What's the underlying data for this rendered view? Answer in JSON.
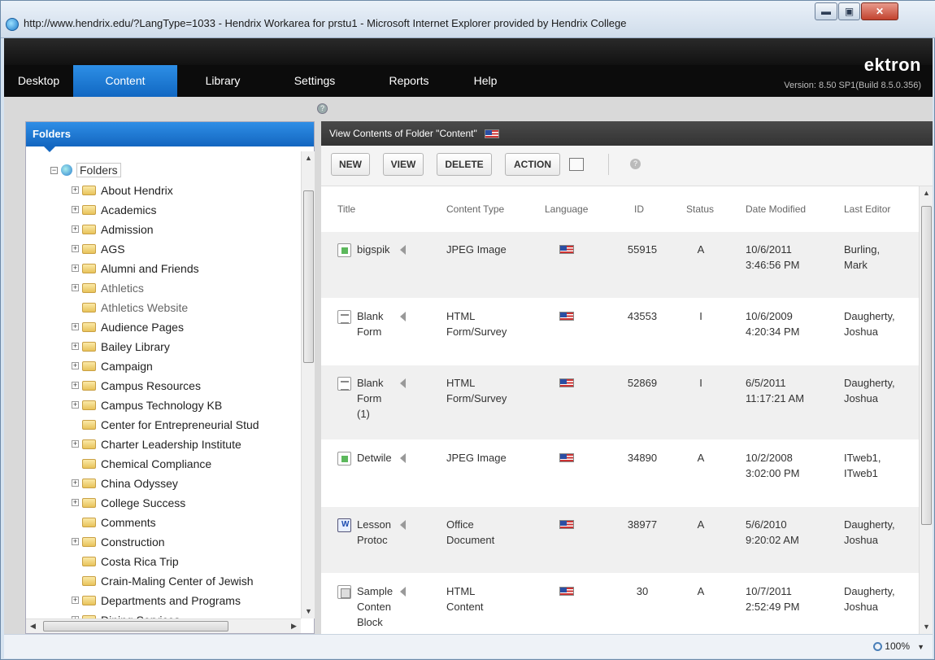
{
  "window": {
    "title": "http://www.hendrix.edu/?LangType=1033 - Hendrix Workarea for prstu1 - Microsoft Internet Explorer provided by Hendrix College",
    "minimize_glyph": "▬",
    "maximize_glyph": "▣",
    "close_glyph": "✕"
  },
  "app": {
    "brand": "ektron",
    "version": "Version: 8.50 SP1(Build 8.5.0.356)",
    "tabs": [
      {
        "label": "Desktop"
      },
      {
        "label": "Content"
      },
      {
        "label": "Library"
      },
      {
        "label": "Settings"
      },
      {
        "label": "Reports"
      },
      {
        "label": "Help"
      }
    ],
    "active_tab": "Content",
    "help_glyph": "?"
  },
  "folders_panel": {
    "header": "Folders",
    "root_label": "Folders",
    "root_expander": "⊟",
    "items": [
      {
        "label": "About Hendrix",
        "expander": "+"
      },
      {
        "label": "Academics",
        "expander": "+"
      },
      {
        "label": "Admission",
        "expander": "+"
      },
      {
        "label": "AGS",
        "expander": "+"
      },
      {
        "label": "Alumni and Friends",
        "expander": "+"
      },
      {
        "label": "Athletics",
        "expander": "+"
      },
      {
        "label": "Athletics Website",
        "expander": ""
      },
      {
        "label": "Audience Pages",
        "expander": "+"
      },
      {
        "label": "Bailey Library",
        "expander": "+"
      },
      {
        "label": "Campaign",
        "expander": "+"
      },
      {
        "label": "Campus Resources",
        "expander": "+"
      },
      {
        "label": "Campus Technology KB",
        "expander": "+"
      },
      {
        "label": "Center for Entrepreneurial Stud",
        "expander": ""
      },
      {
        "label": "Charter Leadership Institute",
        "expander": "+"
      },
      {
        "label": "Chemical Compliance",
        "expander": ""
      },
      {
        "label": "China Odyssey",
        "expander": "+"
      },
      {
        "label": "College Success",
        "expander": "+"
      },
      {
        "label": "Comments",
        "expander": ""
      },
      {
        "label": "Construction",
        "expander": "+"
      },
      {
        "label": "Costa Rica Trip",
        "expander": ""
      },
      {
        "label": "Crain-Maling Center of Jewish",
        "expander": ""
      },
      {
        "label": "Departments and Programs",
        "expander": "+"
      },
      {
        "label": "Dining Services",
        "expander": "+"
      }
    ],
    "scroll": {
      "up": "▲",
      "down": "▼",
      "left": "◀",
      "right": "▶",
      "grip": "≡",
      "hgrip": "III"
    }
  },
  "view_panel": {
    "header": "View Contents of Folder \"Content\"",
    "toolbar": {
      "new": "NEW",
      "view": "VIEW",
      "delete": "DELETE",
      "action": "ACTION",
      "help_glyph": "?"
    },
    "columns": [
      "Title",
      "Content Type",
      "Language",
      "ID",
      "Status",
      "Date Modified",
      "Last Editor"
    ],
    "rows": [
      {
        "icon": "image-icon",
        "title": [
          "bigspik"
        ],
        "type": [
          "JPEG Image"
        ],
        "id": "55915",
        "status": "A",
        "date": [
          "10/6/2011",
          "3:46:56 PM"
        ],
        "editor": [
          "Burling,",
          "Mark"
        ]
      },
      {
        "icon": "form-icon",
        "title": [
          "Blank",
          "Form"
        ],
        "type": [
          "HTML",
          "Form/Survey"
        ],
        "id": "43553",
        "status": "I",
        "date": [
          "10/6/2009",
          "4:20:34 PM"
        ],
        "editor": [
          "Daugherty,",
          "Joshua"
        ]
      },
      {
        "icon": "form-icon",
        "title": [
          "Blank",
          "Form",
          "(1)"
        ],
        "type": [
          "HTML",
          "Form/Survey"
        ],
        "id": "52869",
        "status": "I",
        "date": [
          "6/5/2011",
          "11:17:21 AM"
        ],
        "editor": [
          "Daugherty,",
          "Joshua"
        ]
      },
      {
        "icon": "image-icon",
        "title": [
          "Detwile"
        ],
        "type": [
          "JPEG Image"
        ],
        "id": "34890",
        "status": "A",
        "date": [
          "10/2/2008",
          "3:02:00 PM"
        ],
        "editor": [
          "ITweb1,",
          "ITweb1"
        ]
      },
      {
        "icon": "document-icon",
        "title": [
          "Lesson",
          "Protoc"
        ],
        "type": [
          "Office",
          "Document"
        ],
        "id": "38977",
        "status": "A",
        "date": [
          "5/6/2010",
          "9:20:02 AM"
        ],
        "editor": [
          "Daugherty,",
          "Joshua"
        ]
      },
      {
        "icon": "content-block-icon",
        "title": [
          "Sample",
          "Conten",
          "Block"
        ],
        "type": [
          "HTML",
          "Content"
        ],
        "id": "30",
        "status": "A",
        "date": [
          "10/7/2011",
          "2:52:49 PM"
        ],
        "editor": [
          "Daugherty,",
          "Joshua"
        ]
      }
    ]
  },
  "statusbar": {
    "zoom": "100%",
    "zoom_arrow": "▼"
  }
}
